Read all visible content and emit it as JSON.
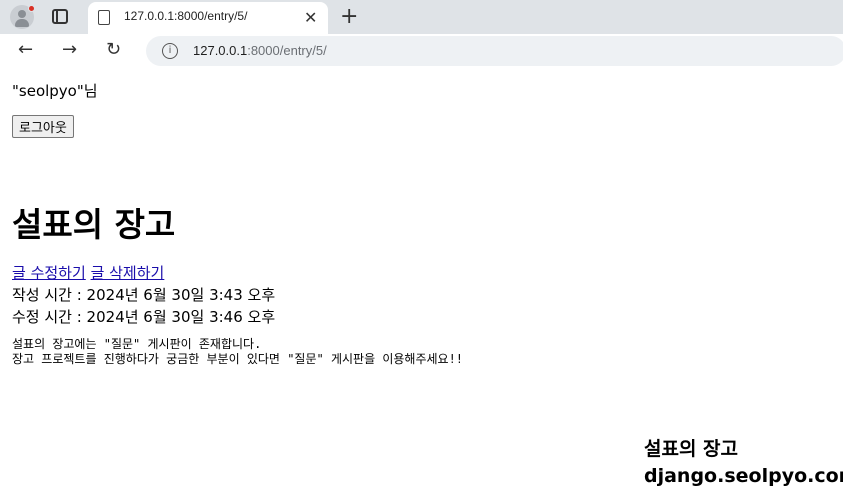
{
  "browser": {
    "tab_title": "127.0.0.1:8000/entry/5/",
    "url_host": "127.0.0.1",
    "url_path": ":8000/entry/5/"
  },
  "page": {
    "user_greeting": "\"seolpyo\"님",
    "logout_label": "로그아웃",
    "title": "설표의 장고",
    "edit_link": "글 수정하기",
    "delete_link": "글 삭제하기",
    "created_at": "작성 시간 : 2024년 6월 30일 3:43 오후",
    "updated_at": "수정 시간 : 2024년 6월 30일 3:46 오후",
    "body_line1": "설표의 장고에는 \"질문\" 게시판이 존재합니다.",
    "body_line2": "장고 프로젝트를 진행하다가 궁금한 부분이 있다면 \"질문\" 게시판을 이용해주세요!!",
    "footer_title": "설표의 장고",
    "footer_domain": "django.seolpyo.com"
  }
}
